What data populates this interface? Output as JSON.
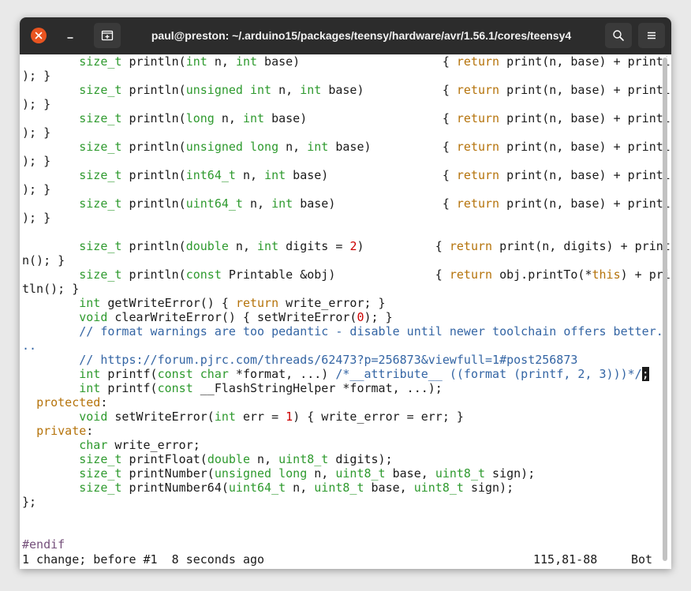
{
  "window": {
    "title": "paul@preston: ~/.arduino15/packages/teensy/hardware/avr/1.56.1/cores/teensy4"
  },
  "colors": {
    "titlebar": "#2c2c2c",
    "close_button": "#e95420",
    "type": "#2e9a2e",
    "keyword": "#b5730b",
    "number": "#cc0000",
    "comment": "#3465a4",
    "preprocessor": "#75507b"
  },
  "icons": {
    "close": "close-icon",
    "minimize": "minimize-icon",
    "new_tab": "new-tab-icon",
    "search": "search-icon",
    "menu": "hamburger-menu-icon"
  },
  "code_lines": [
    [
      [
        "t",
        "        "
      ],
      [
        "type",
        "size_t"
      ],
      [
        "t",
        " println("
      ],
      [
        "type",
        "int"
      ],
      [
        "t",
        " n, "
      ],
      [
        "type",
        "int"
      ],
      [
        "t",
        " base)                    { "
      ],
      [
        "kw",
        "return"
      ],
      [
        "t",
        " print(n, base) + println("
      ]
    ],
    [
      [
        "t",
        "); }"
      ]
    ],
    [
      [
        "t",
        "        "
      ],
      [
        "type",
        "size_t"
      ],
      [
        "t",
        " println("
      ],
      [
        "type",
        "unsigned"
      ],
      [
        "t",
        " "
      ],
      [
        "type",
        "int"
      ],
      [
        "t",
        " n, "
      ],
      [
        "type",
        "int"
      ],
      [
        "t",
        " base)           { "
      ],
      [
        "kw",
        "return"
      ],
      [
        "t",
        " print(n, base) + println("
      ]
    ],
    [
      [
        "t",
        "); }"
      ]
    ],
    [
      [
        "t",
        "        "
      ],
      [
        "type",
        "size_t"
      ],
      [
        "t",
        " println("
      ],
      [
        "type",
        "long"
      ],
      [
        "t",
        " n, "
      ],
      [
        "type",
        "int"
      ],
      [
        "t",
        " base)                   { "
      ],
      [
        "kw",
        "return"
      ],
      [
        "t",
        " print(n, base) + println("
      ]
    ],
    [
      [
        "t",
        "); }"
      ]
    ],
    [
      [
        "t",
        "        "
      ],
      [
        "type",
        "size_t"
      ],
      [
        "t",
        " println("
      ],
      [
        "type",
        "unsigned"
      ],
      [
        "t",
        " "
      ],
      [
        "type",
        "long"
      ],
      [
        "t",
        " n, "
      ],
      [
        "type",
        "int"
      ],
      [
        "t",
        " base)          { "
      ],
      [
        "kw",
        "return"
      ],
      [
        "t",
        " print(n, base) + println("
      ]
    ],
    [
      [
        "t",
        "); }"
      ]
    ],
    [
      [
        "t",
        "        "
      ],
      [
        "type",
        "size_t"
      ],
      [
        "t",
        " println("
      ],
      [
        "type",
        "int64_t"
      ],
      [
        "t",
        " n, "
      ],
      [
        "type",
        "int"
      ],
      [
        "t",
        " base)                { "
      ],
      [
        "kw",
        "return"
      ],
      [
        "t",
        " print(n, base) + println("
      ]
    ],
    [
      [
        "t",
        "); }"
      ]
    ],
    [
      [
        "t",
        "        "
      ],
      [
        "type",
        "size_t"
      ],
      [
        "t",
        " println("
      ],
      [
        "type",
        "uint64_t"
      ],
      [
        "t",
        " n, "
      ],
      [
        "type",
        "int"
      ],
      [
        "t",
        " base)               { "
      ],
      [
        "kw",
        "return"
      ],
      [
        "t",
        " print(n, base) + println("
      ]
    ],
    [
      [
        "t",
        "); }"
      ]
    ],
    [
      [
        "t",
        ""
      ]
    ],
    [
      [
        "t",
        "        "
      ],
      [
        "type",
        "size_t"
      ],
      [
        "t",
        " println("
      ],
      [
        "type",
        "double"
      ],
      [
        "t",
        " n, "
      ],
      [
        "type",
        "int"
      ],
      [
        "t",
        " digits = "
      ],
      [
        "num",
        "2"
      ],
      [
        "t",
        ")          { "
      ],
      [
        "kw",
        "return"
      ],
      [
        "t",
        " print(n, digits) + printl"
      ]
    ],
    [
      [
        "t",
        "n(); }"
      ]
    ],
    [
      [
        "t",
        "        "
      ],
      [
        "type",
        "size_t"
      ],
      [
        "t",
        " println("
      ],
      [
        "type",
        "const"
      ],
      [
        "t",
        " Printable &obj)              { "
      ],
      [
        "kw",
        "return"
      ],
      [
        "t",
        " obj.printTo(*"
      ],
      [
        "kw",
        "this"
      ],
      [
        "t",
        ") + prin"
      ]
    ],
    [
      [
        "t",
        "tln(); }"
      ]
    ],
    [
      [
        "t",
        "        "
      ],
      [
        "type",
        "int"
      ],
      [
        "t",
        " getWriteError() { "
      ],
      [
        "kw",
        "return"
      ],
      [
        "t",
        " write_error; }"
      ]
    ],
    [
      [
        "t",
        "        "
      ],
      [
        "type",
        "void"
      ],
      [
        "t",
        " clearWriteError() { setWriteError("
      ],
      [
        "num",
        "0"
      ],
      [
        "t",
        "); }"
      ]
    ],
    [
      [
        "t",
        "        "
      ],
      [
        "cmt",
        "// format warnings are too pedantic - disable until newer toolchain offers better."
      ]
    ],
    [
      [
        "cmt",
        ".."
      ]
    ],
    [
      [
        "t",
        "        "
      ],
      [
        "cmt",
        "// https://forum.pjrc.com/threads/62473?p=256873&viewfull=1#post256873"
      ]
    ],
    [
      [
        "t",
        "        "
      ],
      [
        "type",
        "int"
      ],
      [
        "t",
        " printf("
      ],
      [
        "type",
        "const"
      ],
      [
        "t",
        " "
      ],
      [
        "type",
        "char"
      ],
      [
        "t",
        " *format, ...) "
      ],
      [
        "cmt",
        "/*__attribute__ ((format (printf, 2, 3)))*/"
      ],
      [
        "cur",
        ";"
      ]
    ],
    [
      [
        "t",
        "        "
      ],
      [
        "type",
        "int"
      ],
      [
        "t",
        " printf("
      ],
      [
        "type",
        "const"
      ],
      [
        "t",
        " __FlashStringHelper *format, ...);"
      ]
    ],
    [
      [
        "t",
        "  "
      ],
      [
        "kw",
        "protected"
      ],
      [
        "t",
        ":"
      ]
    ],
    [
      [
        "t",
        "        "
      ],
      [
        "type",
        "void"
      ],
      [
        "t",
        " setWriteError("
      ],
      [
        "type",
        "int"
      ],
      [
        "t",
        " err = "
      ],
      [
        "num",
        "1"
      ],
      [
        "t",
        ") { write_error = err; }"
      ]
    ],
    [
      [
        "t",
        "  "
      ],
      [
        "kw",
        "private"
      ],
      [
        "t",
        ":"
      ]
    ],
    [
      [
        "t",
        "        "
      ],
      [
        "type",
        "char"
      ],
      [
        "t",
        " write_error;"
      ]
    ],
    [
      [
        "t",
        "        "
      ],
      [
        "type",
        "size_t"
      ],
      [
        "t",
        " printFloat("
      ],
      [
        "type",
        "double"
      ],
      [
        "t",
        " n, "
      ],
      [
        "type",
        "uint8_t"
      ],
      [
        "t",
        " digits);"
      ]
    ],
    [
      [
        "t",
        "        "
      ],
      [
        "type",
        "size_t"
      ],
      [
        "t",
        " printNumber("
      ],
      [
        "type",
        "unsigned"
      ],
      [
        "t",
        " "
      ],
      [
        "type",
        "long"
      ],
      [
        "t",
        " n, "
      ],
      [
        "type",
        "uint8_t"
      ],
      [
        "t",
        " base, "
      ],
      [
        "type",
        "uint8_t"
      ],
      [
        "t",
        " sign);"
      ]
    ],
    [
      [
        "t",
        "        "
      ],
      [
        "type",
        "size_t"
      ],
      [
        "t",
        " printNumber64("
      ],
      [
        "type",
        "uint64_t"
      ],
      [
        "t",
        " n, "
      ],
      [
        "type",
        "uint8_t"
      ],
      [
        "t",
        " base, "
      ],
      [
        "type",
        "uint8_t"
      ],
      [
        "t",
        " sign);"
      ]
    ],
    [
      [
        "t",
        "};"
      ]
    ],
    [
      [
        "t",
        ""
      ]
    ],
    [
      [
        "t",
        ""
      ]
    ],
    [
      [
        "pre",
        "#endif"
      ]
    ]
  ],
  "status": {
    "message": "1 change; before #1  8 seconds ago",
    "position": "115,81-88",
    "scroll": "Bot"
  }
}
